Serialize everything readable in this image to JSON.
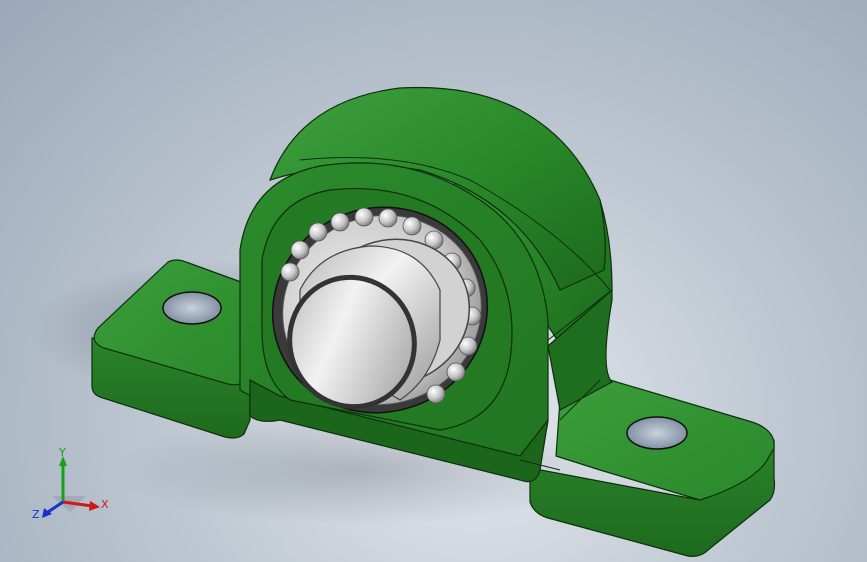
{
  "window": {
    "kind": "3D CAD graphics viewport"
  },
  "model": {
    "part": "pillow-block-bearing",
    "housing_color": "#2e8b2e",
    "insert_color": "#c8c8c8",
    "shaft_color": "#d6d6d6"
  },
  "triad": {
    "x_label": "X",
    "y_label": "Y",
    "z_label": "Z",
    "x_color": "#d01818",
    "y_color": "#18a018",
    "z_color": "#1830d0"
  }
}
